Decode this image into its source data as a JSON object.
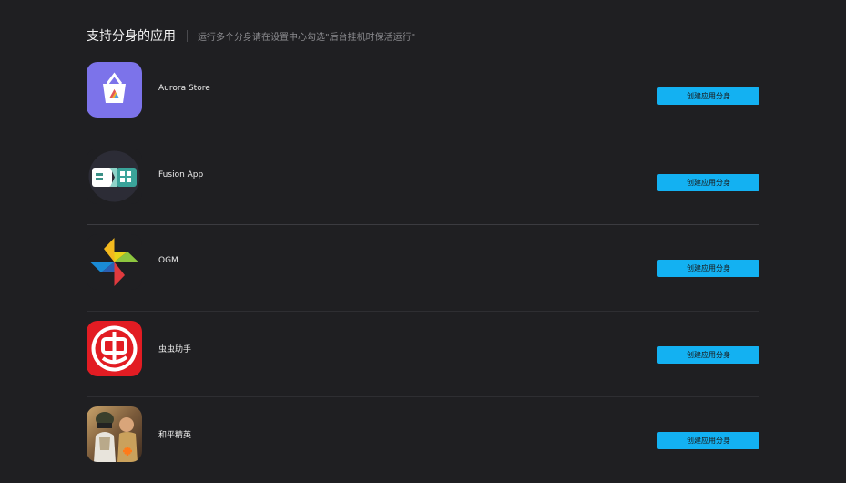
{
  "header": {
    "title": "支持分身的应用",
    "subtitle": "运行多个分身请在设置中心勾选\"后台挂机时保活运行\""
  },
  "apps": [
    {
      "name": "Aurora Store",
      "icon": "aurora-store-icon",
      "button": "创建应用分身"
    },
    {
      "name": "Fusion App",
      "icon": "fusion-app-icon",
      "button": "创建应用分身"
    },
    {
      "name": "OGM",
      "icon": "ogm-pinwheel-icon",
      "button": "创建应用分身"
    },
    {
      "name": "虫虫助手",
      "icon": "chongchong-helper-icon",
      "button": "创建应用分身"
    },
    {
      "name": "和平精英",
      "icon": "peace-elite-game-icon",
      "button": "创建应用分身"
    }
  ],
  "colors": {
    "background": "#1f1f22",
    "button": "#13b1f2",
    "divider": "#2e2e32"
  }
}
